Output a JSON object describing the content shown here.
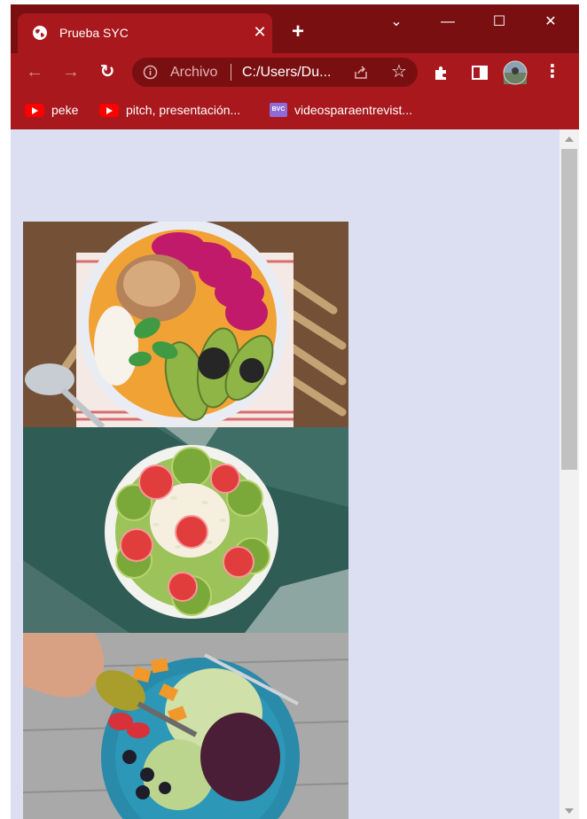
{
  "tab": {
    "title": "Prueba SYC",
    "close_glyph": "✕",
    "new_tab_glyph": "+"
  },
  "window_controls": {
    "dropdown_glyph": "⌄",
    "minimize_glyph": "—",
    "maximize_glyph": "☐",
    "close_glyph": "✕"
  },
  "toolbar": {
    "back_glyph": "←",
    "forward_glyph": "→",
    "reload_glyph": "↻",
    "menu_glyph": "⋮"
  },
  "omnibox": {
    "scheme_label": "Archivo",
    "url": "C:/Users/Du...",
    "star_glyph": "☆"
  },
  "bookmarks": [
    {
      "label": "peke",
      "icon": "youtube-icon"
    },
    {
      "label": "pitch, presentación...",
      "icon": "youtube-icon"
    },
    {
      "label": "videosparaentrevist...",
      "icon": "video-icon"
    }
  ],
  "colors": {
    "tab_strip": "#7a0f12",
    "toolbar": "#a8181c",
    "page_background": "#dcdff1"
  },
  "images": [
    {
      "name": "dragon-fruit-bowl"
    },
    {
      "name": "kiwi-strawberry-bowl"
    },
    {
      "name": "salad-plate"
    }
  ]
}
